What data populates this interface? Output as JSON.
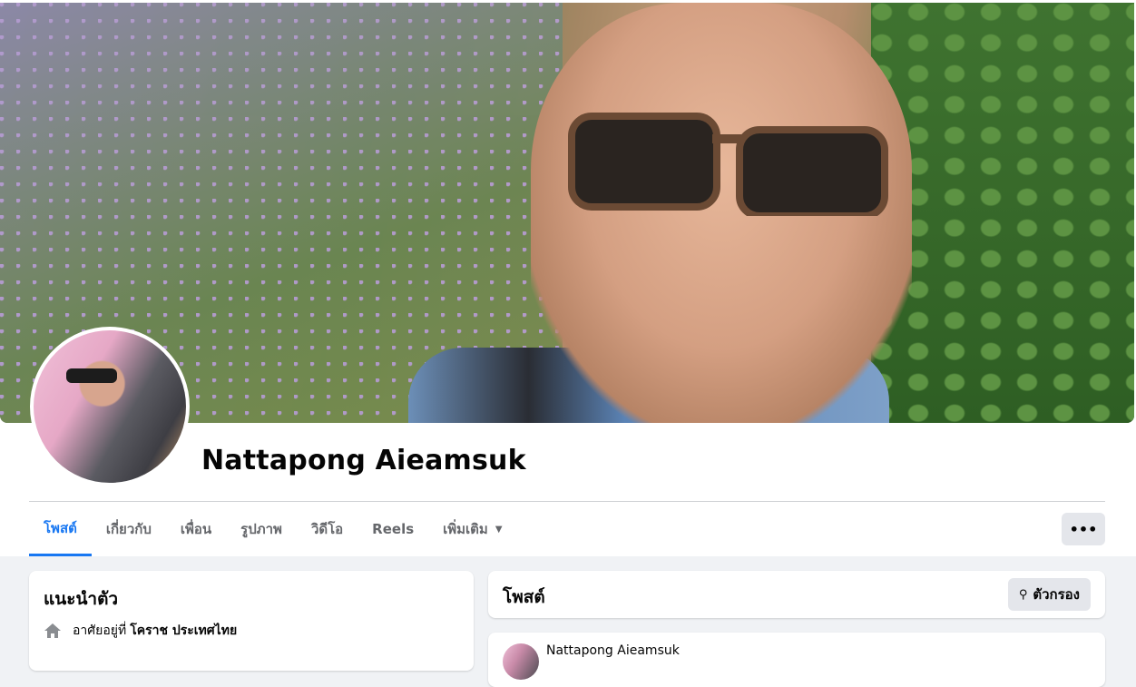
{
  "profile": {
    "name": "Nattapong Aieamsuk"
  },
  "tabs": [
    {
      "label": "โพสต์",
      "active": true
    },
    {
      "label": "เกี่ยวกับ"
    },
    {
      "label": "เพื่อน"
    },
    {
      "label": "รูปภาพ"
    },
    {
      "label": "วิดีโอ"
    },
    {
      "label": "Reels"
    },
    {
      "label": "เพิ่มเติม"
    }
  ],
  "more_button": {
    "label": "•••"
  },
  "intro": {
    "title": "แนะนำตัว",
    "lives_prefix": "อาศัยอยู่ที่",
    "lives_place": "โคราช ประเทศไทย"
  },
  "posts": {
    "title": "โพสต์",
    "filter_label": "ตัวกรอง"
  },
  "post_preview": {
    "author": "Nattapong Aieamsuk"
  },
  "colors": {
    "accent": "#1877f2",
    "background": "#f0f2f5",
    "button_gray": "#e4e6eb"
  }
}
